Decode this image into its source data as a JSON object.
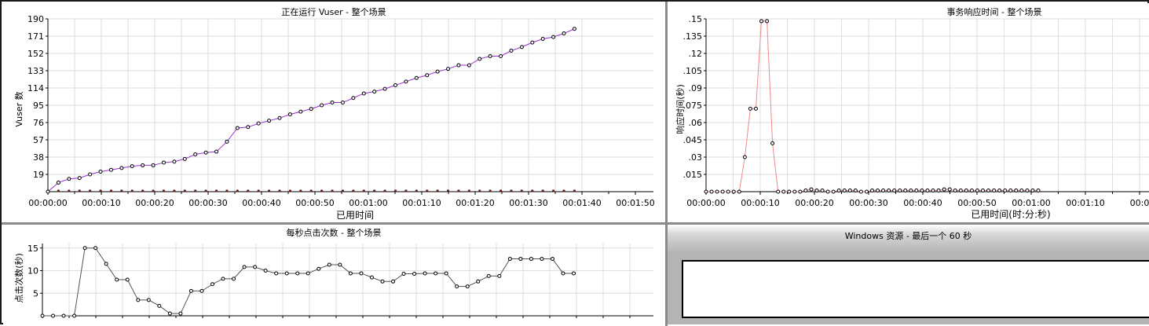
{
  "charts": {
    "vusers": {
      "title": "正在运行 Vuser - 整个场景",
      "xlabel": "已用时间",
      "ylabel": "Vuser 数",
      "yticks": [
        "19",
        "38",
        "57",
        "76",
        "95",
        "114",
        "133",
        "152",
        "171",
        "190"
      ],
      "xticks": [
        "00:00:00",
        "00:00:10",
        "00:00:20",
        "00:00:30",
        "00:00:40",
        "00:00:50",
        "00:01:00",
        "00:01:10",
        "00:01:20",
        "00:01:30",
        "00:01:40",
        "00:01:50"
      ],
      "line_color": "#9a2fd0"
    },
    "response": {
      "title": "事务响应时间 - 整个场景",
      "xlabel": "已用时间(时:分:秒)",
      "ylabel": "响应时间(秒)",
      "yticks": [
        ".015",
        ".03",
        ".045",
        ".06",
        ".075",
        ".09",
        ".105",
        ".12",
        ".135",
        ".15"
      ],
      "xticks": [
        "00:00:00",
        "00:00:10",
        "00:00:20",
        "00:00:30",
        "00:00:40",
        "00:00:50",
        "00:01:00",
        "00:01:10",
        "00:0"
      ],
      "line_color": "#f08a8a"
    },
    "hits": {
      "title": "每秒点击次数 - 整个场景",
      "ylabel": "点击次数(秒)",
      "yticks": [
        "5",
        "10",
        "15"
      ],
      "line_color": "#555555"
    },
    "windows": {
      "title": "Windows 资源 - 最后一个 60 秒"
    }
  },
  "chart_data": [
    {
      "type": "line",
      "title": "正在运行 Vuser - 整个场景",
      "xlabel": "已用时间",
      "ylabel": "Vuser 数",
      "xlim": [
        0,
        115
      ],
      "ylim": [
        0,
        190
      ],
      "grid": true,
      "x": [
        0,
        2,
        4,
        6,
        8,
        10,
        12,
        14,
        16,
        18,
        20,
        22,
        24,
        26,
        28,
        30,
        32,
        34,
        36,
        38,
        40,
        42,
        44,
        46,
        48,
        50,
        52,
        54,
        56,
        58,
        60,
        62,
        64,
        66,
        68,
        70,
        72,
        74,
        76,
        78,
        80,
        82,
        84,
        86,
        88,
        90,
        92,
        94,
        96,
        98,
        100
      ],
      "series": [
        {
          "values": [
            0,
            10,
            14,
            15,
            19,
            22,
            24,
            26,
            28,
            29,
            29,
            32,
            33,
            36,
            41,
            43,
            44,
            55,
            70,
            71,
            75,
            78,
            81,
            85,
            88,
            91,
            95,
            98,
            98,
            103,
            108,
            110,
            113,
            117,
            121,
            125,
            128,
            132,
            135,
            139,
            139,
            146,
            149,
            149,
            155,
            159,
            164,
            168,
            170,
            174,
            179
          ]
        }
      ]
    },
    {
      "type": "line",
      "title": "事务响应时间 - 整个场景",
      "xlabel": "已用时间(时:分:秒)",
      "ylabel": "响应时间(秒)",
      "xlim": [
        0,
        80
      ],
      "ylim": [
        0,
        0.15
      ],
      "grid": true,
      "x": [
        0,
        1,
        2,
        3,
        4,
        5,
        6,
        7,
        8,
        9,
        10,
        11,
        12,
        13,
        14,
        15,
        16,
        17,
        18,
        19,
        20,
        21,
        22,
        23,
        24,
        25,
        26,
        27,
        28,
        29,
        30,
        31,
        32,
        33,
        34,
        35,
        36,
        37,
        38,
        39,
        40,
        41,
        42,
        43,
        44,
        45,
        46,
        47,
        48,
        49,
        50,
        51,
        52,
        53,
        54,
        55,
        56,
        57,
        58,
        59,
        60
      ],
      "series": [
        {
          "values": [
            0,
            0,
            0,
            0,
            0,
            0,
            0,
            0.03,
            0.072,
            0.072,
            0.148,
            0.148,
            0.042,
            0,
            0,
            0,
            0,
            0,
            0.001,
            0.002,
            0.001,
            0.001,
            0,
            0,
            0.001,
            0.001,
            0.001,
            0.001,
            0,
            0,
            0.001,
            0.001,
            0.001,
            0.001,
            0.001,
            0.001,
            0.001,
            0.001,
            0.001,
            0.001,
            0.001,
            0.001,
            0.001,
            0.002,
            0.002,
            0.001,
            0.001,
            0.001,
            0.001,
            0.001,
            0.001,
            0.001,
            0.001,
            0.001,
            0.001,
            0.001,
            0.001,
            0.001,
            0.001,
            0.001,
            0.001
          ]
        }
      ]
    },
    {
      "type": "line",
      "title": "每秒点击次数 - 整个场景",
      "ylabel": "点击次数(秒)",
      "xlim": [
        0,
        115
      ],
      "ylim": [
        0,
        16
      ],
      "grid": true,
      "x": [
        0,
        2,
        4,
        6,
        8,
        10,
        12,
        14,
        16,
        18,
        20,
        22,
        24,
        26,
        28,
        30,
        32,
        34,
        36,
        38,
        40,
        42,
        44,
        46,
        48,
        50,
        52,
        54,
        56,
        58,
        60,
        62,
        64,
        66,
        68,
        70,
        72,
        74,
        76,
        78,
        80,
        82,
        84,
        86,
        88,
        90,
        92,
        94,
        96,
        98,
        100
      ],
      "series": [
        {
          "values": [
            0,
            0,
            0,
            0,
            15,
            15,
            11.5,
            8,
            8,
            3.5,
            3.5,
            2.2,
            0.5,
            0.5,
            5.5,
            5.5,
            7,
            8.2,
            8.2,
            10.8,
            10.8,
            10,
            9.4,
            9.4,
            9.4,
            9.4,
            10.4,
            11.3,
            11.3,
            9.4,
            9.4,
            8.5,
            7.6,
            7.6,
            9.3,
            9.3,
            9.4,
            9.4,
            9.4,
            6.5,
            6.5,
            7.6,
            8.8,
            8.8,
            12.6,
            12.6,
            12.6,
            12.6,
            12.6,
            9.4,
            9.4
          ]
        }
      ]
    }
  ]
}
